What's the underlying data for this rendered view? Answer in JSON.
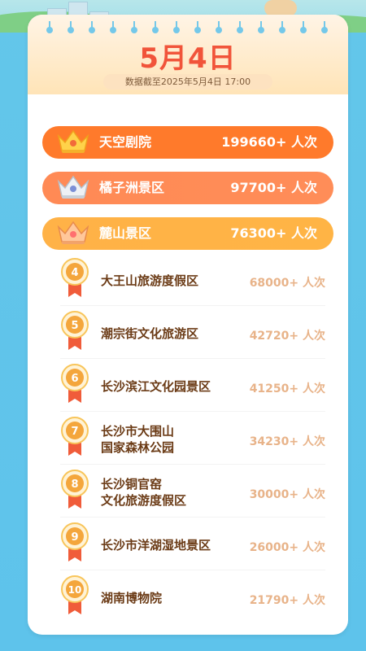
{
  "header": {
    "date": "5月4日",
    "updated": "数据截至2025年5月4日 17:00"
  },
  "top3": [
    {
      "name": "天空剧院",
      "value": "199660+ 人次"
    },
    {
      "name": "橘子洲景区",
      "value": "97700+ 人次"
    },
    {
      "name": "麓山景区",
      "value": "76300+ 人次"
    }
  ],
  "list": [
    {
      "rank": "4",
      "line1": "大王山旅游度假区",
      "line2": "",
      "value": "68000+ 人次"
    },
    {
      "rank": "5",
      "line1": "潮宗街文化旅游区",
      "line2": "",
      "value": "42720+ 人次"
    },
    {
      "rank": "6",
      "line1": "长沙滨江文化园景区",
      "line2": "",
      "value": "41250+ 人次"
    },
    {
      "rank": "7",
      "line1": "长沙市大围山",
      "line2": "国家森林公园",
      "value": "34230+ 人次"
    },
    {
      "rank": "8",
      "line1": "长沙铜官窑",
      "line2": "文化旅游度假区",
      "value": "30000+ 人次"
    },
    {
      "rank": "9",
      "line1": "长沙市洋湖湿地景区",
      "line2": "",
      "value": "26000+ 人次"
    },
    {
      "rank": "10",
      "line1": "湖南博物院",
      "line2": "",
      "value": "21790+ 人次"
    }
  ],
  "icons": {
    "crown_gold": "crown-gold-icon",
    "crown_silver": "crown-silver-icon",
    "crown_bronze": "crown-bronze-icon",
    "medal": "rank-medal-icon"
  },
  "colors": {
    "rank1": "#ff7a2b",
    "rank2": "#ff8d58",
    "rank3": "#ffb445",
    "title": "#f1543a",
    "name": "#6b3b16",
    "value": "#e8b389"
  }
}
